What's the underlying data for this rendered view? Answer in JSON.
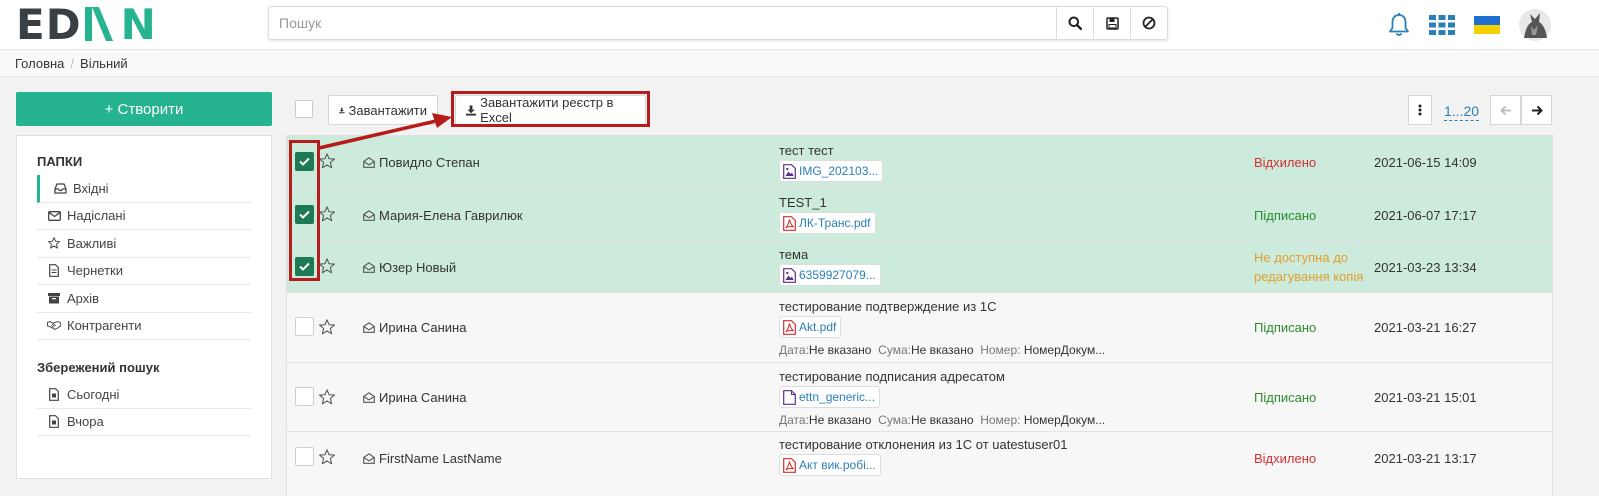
{
  "header": {
    "logo_left": "ED",
    "logo_right": "N",
    "search_placeholder": "Пошук"
  },
  "breadcrumb": {
    "home": "Головна",
    "current": "Вільний"
  },
  "sidebar": {
    "create_label": "+ Створити",
    "folders_title": "ПАПКИ",
    "folders": [
      {
        "label": "Вхідні",
        "icon": "inbox-icon"
      },
      {
        "label": "Надіслані",
        "icon": "envelope-icon"
      },
      {
        "label": "Важливі",
        "icon": "star-icon"
      },
      {
        "label": "Чернетки",
        "icon": "draft-icon"
      },
      {
        "label": "Архів",
        "icon": "archive-icon"
      },
      {
        "label": "Контрагенти",
        "icon": "handshake-icon"
      }
    ],
    "saved_title": "Збережений пошук",
    "saved": [
      {
        "label": "Сьогодні",
        "icon": "saved-doc-icon"
      },
      {
        "label": "Вчора",
        "icon": "saved-doc-icon"
      }
    ]
  },
  "toolbar": {
    "download_label": "Завантажити",
    "excel_label": "Завантажити реєстр в Excel",
    "pager_range": "1...20"
  },
  "meta_labels": {
    "date": "Дата:",
    "sum": "Сума:",
    "number": "Номер:"
  },
  "colors": {
    "accent": "#26b38f",
    "selected_row": "#cdebdc",
    "highlight": "#b71c1c",
    "rejected": "#d32f2f",
    "signed": "#2e8b2e",
    "unavailable": "#e0a030"
  },
  "rows": [
    {
      "checked": true,
      "sender": "Повидло Степан",
      "subject": "тест тест",
      "attachment": "IMG_202103...",
      "file_type": "image",
      "status": "Відхилено",
      "status_type": "rejected",
      "date": "2021-06-15 14:09"
    },
    {
      "checked": true,
      "sender": "Мария-Елена Гаврилюк",
      "subject": "TEST_1",
      "attachment": "ЛК-Транс.pdf",
      "file_type": "pdf",
      "status": "Підписано",
      "status_type": "signed",
      "date": "2021-06-07 17:17"
    },
    {
      "checked": true,
      "sender": "Юзер Новый",
      "subject": "тема",
      "attachment": "6359927079...",
      "file_type": "image",
      "status": "Не доступна до редагування копія",
      "status_line1": "Не доступна до",
      "status_line2": "редагування копія",
      "status_type": "unavailable",
      "date": "2021-03-23 13:34"
    },
    {
      "checked": false,
      "sender": "Ирина Санина",
      "subject": "тестирование подтверждение из 1С",
      "attachment": "Akt.pdf",
      "file_type": "pdf",
      "meta_date": "Не вказано",
      "meta_sum": "Не вказано",
      "meta_number": "НомерДокум...",
      "status": "Підписано",
      "status_type": "signed",
      "date": "2021-03-21 16:27"
    },
    {
      "checked": false,
      "sender": "Ирина Санина",
      "subject": "тестирование подписания адресатом",
      "attachment": "ettn_generic...",
      "file_type": "doc",
      "meta_date": "Не вказано",
      "meta_sum": "Не вказано",
      "meta_number": "НомерДокум...",
      "status": "Підписано",
      "status_type": "signed",
      "date": "2021-03-21 15:01"
    },
    {
      "checked": false,
      "sender": "FirstName LastName",
      "subject": "тестирование отклонения из 1С от uatestuser01",
      "attachment": "Акт вик.робі...",
      "file_type": "pdf",
      "status": "Відхилено",
      "status_type": "rejected",
      "date": "2021-03-21 13:17"
    }
  ]
}
